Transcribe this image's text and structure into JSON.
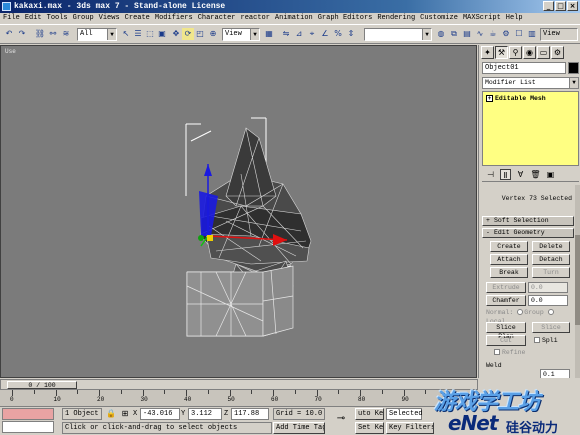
{
  "window": {
    "title": "kakaxi.max - 3ds max 7 - Stand-alone License",
    "buttons": [
      "_",
      "□",
      "×"
    ]
  },
  "menu": [
    "File",
    "Edit",
    "Tools",
    "Group",
    "Views",
    "Create",
    "Modifiers",
    "Character",
    "reactor",
    "Animation",
    "Graph Editors",
    "Rendering",
    "Customize",
    "MAXScript",
    "Help"
  ],
  "toolbar": {
    "selection_filter": "All",
    "ref_coord": "View",
    "named_sel": "",
    "view_btn": "View"
  },
  "viewport": {
    "label": "Use"
  },
  "command_panel": {
    "object_name": "Object01",
    "modifier_list": "Modifier List",
    "stack_item": "Editable Mesh",
    "vertex_selected": "Vertex 73 Selected",
    "soft_selection": "Soft Selection",
    "edit_geometry": "Edit Geometry",
    "buttons": {
      "create": "Create",
      "delete": "Delete",
      "attach": "Attach",
      "detach": "Detach",
      "break": "Break",
      "turn": "Turn",
      "extrude": "Extrude",
      "chamfer": "Chamfer",
      "slice_plane": "Slice Plan",
      "slice": "Slice",
      "cut": "Cut",
      "split": "Spli",
      "refine": "Refine",
      "weld": "Weld"
    },
    "values": {
      "extrude": "0.0",
      "chamfer": "0.0",
      "weld": "0.1"
    },
    "normal_label": "Normal:",
    "group_label": "Group",
    "local_label": "Local"
  },
  "timeline": {
    "frame": "0 / 100",
    "ticks": [
      "0",
      "10",
      "20",
      "30",
      "40",
      "50",
      "60",
      "70",
      "80",
      "90"
    ]
  },
  "status": {
    "object_count": "1 Object",
    "x_label": "X",
    "x_value": "-43.016",
    "y_label": "Y",
    "y_value": "3.112",
    "z_label": "Z",
    "z_value": "117.88",
    "grid": "Grid = 10.0",
    "auto_key": "uto Key",
    "selected": "Selected",
    "prompt": "Click or click-and-drag to select objects",
    "add_time_tag": "Add Time Tag",
    "set_key": "Set Key",
    "key_filters": "Key Filters..."
  },
  "watermark": {
    "cn": "游戏学工坊",
    "enet": "eNet",
    "cn2": "硅谷动力"
  },
  "colors": {
    "viewport_bg": "#7b7b7b",
    "stack_bg": "#ffff82",
    "mesh_dark": "#3a3a3a",
    "gizmo_red": "#e01010",
    "gizmo_blue": "#1a1ae0"
  }
}
